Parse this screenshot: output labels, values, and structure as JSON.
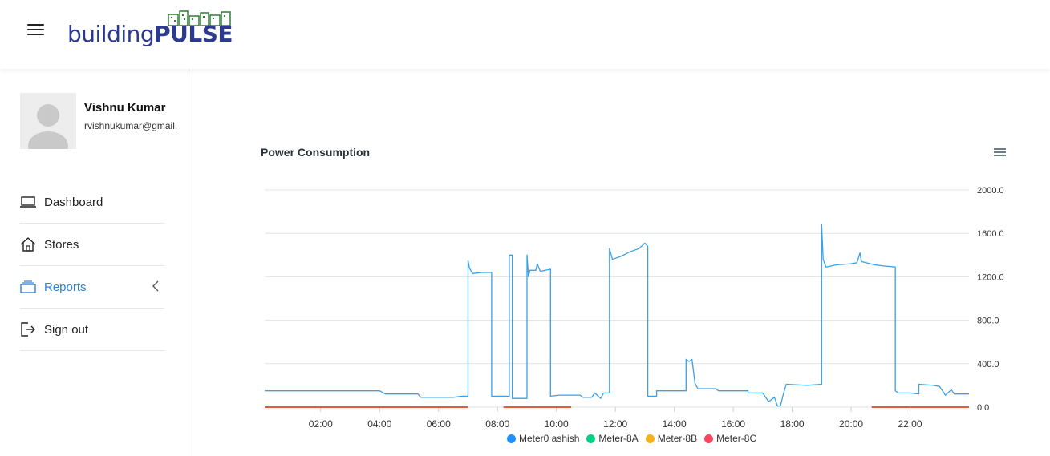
{
  "header": {
    "logo_text_light": "building",
    "logo_text_bold": "PULSE",
    "brand_color": "#2b3a8f",
    "logo_accent_color": "#2e7d32"
  },
  "sidebar": {
    "user": {
      "name": "Vishnu Kumar",
      "email": "rvishnukumar@gmail."
    },
    "items": [
      {
        "label": "Dashboard",
        "icon": "laptop-icon"
      },
      {
        "label": "Stores",
        "icon": "home-icon"
      },
      {
        "label": "Reports",
        "icon": "folder-icon",
        "active": true
      },
      {
        "label": "Sign out",
        "icon": "sign-out-icon"
      }
    ],
    "active_color": "#2f7fd6"
  },
  "chart_data": {
    "type": "line",
    "title": "Power Consumption",
    "x_ticks": [
      "02:00",
      "04:00",
      "06:00",
      "08:00",
      "10:00",
      "12:00",
      "14:00",
      "16:00",
      "18:00",
      "20:00",
      "22:00"
    ],
    "y_ticks": [
      "0.0",
      "400.0",
      "800.0",
      "1200.0",
      "1600.0",
      "2000.0"
    ],
    "ylim": [
      0,
      2000
    ],
    "xlim_hours": [
      0.1,
      24
    ],
    "y_axis_side": "right",
    "grid": true,
    "legend_position": "bottom",
    "series": [
      {
        "name": "Meter0 ashish",
        "color": "#3ba0e6",
        "legend_color": "#1e90ff",
        "points": [
          [
            0.1,
            150
          ],
          [
            2.0,
            150
          ],
          [
            4.0,
            150
          ],
          [
            4.2,
            120
          ],
          [
            5.3,
            120
          ],
          [
            5.4,
            90
          ],
          [
            6.5,
            90
          ],
          [
            6.8,
            100
          ],
          [
            7.0,
            100
          ],
          [
            7.0,
            1350
          ],
          [
            7.05,
            1280
          ],
          [
            7.15,
            1230
          ],
          [
            7.5,
            1240
          ],
          [
            7.8,
            1240
          ],
          [
            7.8,
            100
          ],
          [
            8.4,
            100
          ],
          [
            8.4,
            1400
          ],
          [
            8.5,
            1400
          ],
          [
            8.5,
            80
          ],
          [
            9.0,
            80
          ],
          [
            9.0,
            1400
          ],
          [
            9.05,
            1200
          ],
          [
            9.1,
            1260
          ],
          [
            9.3,
            1260
          ],
          [
            9.35,
            1320
          ],
          [
            9.45,
            1250
          ],
          [
            9.8,
            1270
          ],
          [
            9.8,
            100
          ],
          [
            10.1,
            110
          ],
          [
            10.8,
            110
          ],
          [
            10.9,
            90
          ],
          [
            11.2,
            90
          ],
          [
            11.3,
            130
          ],
          [
            11.5,
            80
          ],
          [
            11.6,
            130
          ],
          [
            11.8,
            130
          ],
          [
            11.8,
            1460
          ],
          [
            11.9,
            1360
          ],
          [
            12.2,
            1390
          ],
          [
            12.5,
            1430
          ],
          [
            12.8,
            1460
          ],
          [
            13.0,
            1510
          ],
          [
            13.1,
            1480
          ],
          [
            13.1,
            100
          ],
          [
            13.4,
            100
          ],
          [
            13.4,
            150
          ],
          [
            14.3,
            150
          ],
          [
            14.4,
            150
          ],
          [
            14.4,
            440
          ],
          [
            14.5,
            420
          ],
          [
            14.6,
            440
          ],
          [
            14.7,
            220
          ],
          [
            14.8,
            170
          ],
          [
            15.4,
            170
          ],
          [
            15.5,
            150
          ],
          [
            16.5,
            150
          ],
          [
            16.5,
            130
          ],
          [
            17.0,
            130
          ],
          [
            17.2,
            50
          ],
          [
            17.4,
            90
          ],
          [
            17.5,
            10
          ],
          [
            17.6,
            10
          ],
          [
            17.7,
            120
          ],
          [
            17.8,
            210
          ],
          [
            18.5,
            200
          ],
          [
            19.0,
            210
          ],
          [
            19.0,
            1680
          ],
          [
            19.05,
            1360
          ],
          [
            19.15,
            1290
          ],
          [
            19.5,
            1310
          ],
          [
            20.0,
            1320
          ],
          [
            20.2,
            1330
          ],
          [
            20.3,
            1420
          ],
          [
            20.35,
            1340
          ],
          [
            20.8,
            1310
          ],
          [
            21.1,
            1300
          ],
          [
            21.5,
            1290
          ],
          [
            21.5,
            150
          ],
          [
            21.6,
            130
          ],
          [
            22.0,
            130
          ],
          [
            22.3,
            120
          ],
          [
            22.3,
            210
          ],
          [
            22.8,
            200
          ],
          [
            23.0,
            190
          ],
          [
            23.2,
            110
          ],
          [
            23.4,
            160
          ],
          [
            23.5,
            120
          ],
          [
            24.0,
            120
          ]
        ]
      },
      {
        "name": "Meter-8A",
        "color": "#00d084",
        "points": []
      },
      {
        "name": "Meter-8B",
        "color": "#f5b21d",
        "points": []
      },
      {
        "name": "Meter-8C",
        "color": "#e05a3c",
        "legend_color": "#ff4560",
        "segments": [
          [
            [
              0.1,
              0
            ],
            [
              7.0,
              0
            ]
          ],
          [
            [
              8.2,
              0
            ],
            [
              10.5,
              0
            ]
          ],
          [
            [
              20.7,
              0
            ],
            [
              24.0,
              0
            ]
          ]
        ]
      }
    ]
  }
}
